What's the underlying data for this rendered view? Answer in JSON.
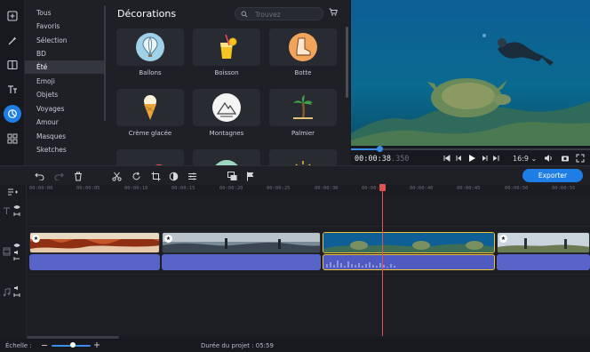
{
  "categories": {
    "items": [
      "Tous",
      "Favoris",
      "Sélection",
      "BD",
      "Été",
      "Emoji",
      "Objets",
      "Voyages",
      "Amour",
      "Masques",
      "Sketches"
    ],
    "selected": "Été"
  },
  "panel": {
    "title": "Décorations",
    "search_placeholder": "Trouvez",
    "stickers": [
      {
        "label": "Ballons",
        "icon": "hot-air-balloon-icon"
      },
      {
        "label": "Boisson",
        "icon": "drink-icon"
      },
      {
        "label": "Botte",
        "icon": "boot-icon"
      },
      {
        "label": "Crème glacée",
        "icon": "ice-cream-icon"
      },
      {
        "label": "Montagnes",
        "icon": "mountains-icon"
      },
      {
        "label": "Palmier",
        "icon": "palm-tree-icon"
      }
    ]
  },
  "player": {
    "time_current": "00:00:38",
    "time_dim": ".350",
    "aspect_ratio": "16:9",
    "progress": 0.12
  },
  "toolbar": {
    "export_label": "Exporter"
  },
  "timeline": {
    "ticks": [
      "00:00:00",
      "00:00:05",
      "00:00:10",
      "00:00:15",
      "00:00:20",
      "00:00:25",
      "00:00:30",
      "00:00:35",
      "00:00:40",
      "00:00:45",
      "00:00:50",
      "00:00:55"
    ]
  },
  "status": {
    "scale_label": "Échelle :",
    "duration": "Durée du projet : 05:59"
  },
  "colors": {
    "accent": "#1f7ee6",
    "playhead": "#e05353",
    "selection": "#f0c23a",
    "audio": "#5864c7"
  }
}
